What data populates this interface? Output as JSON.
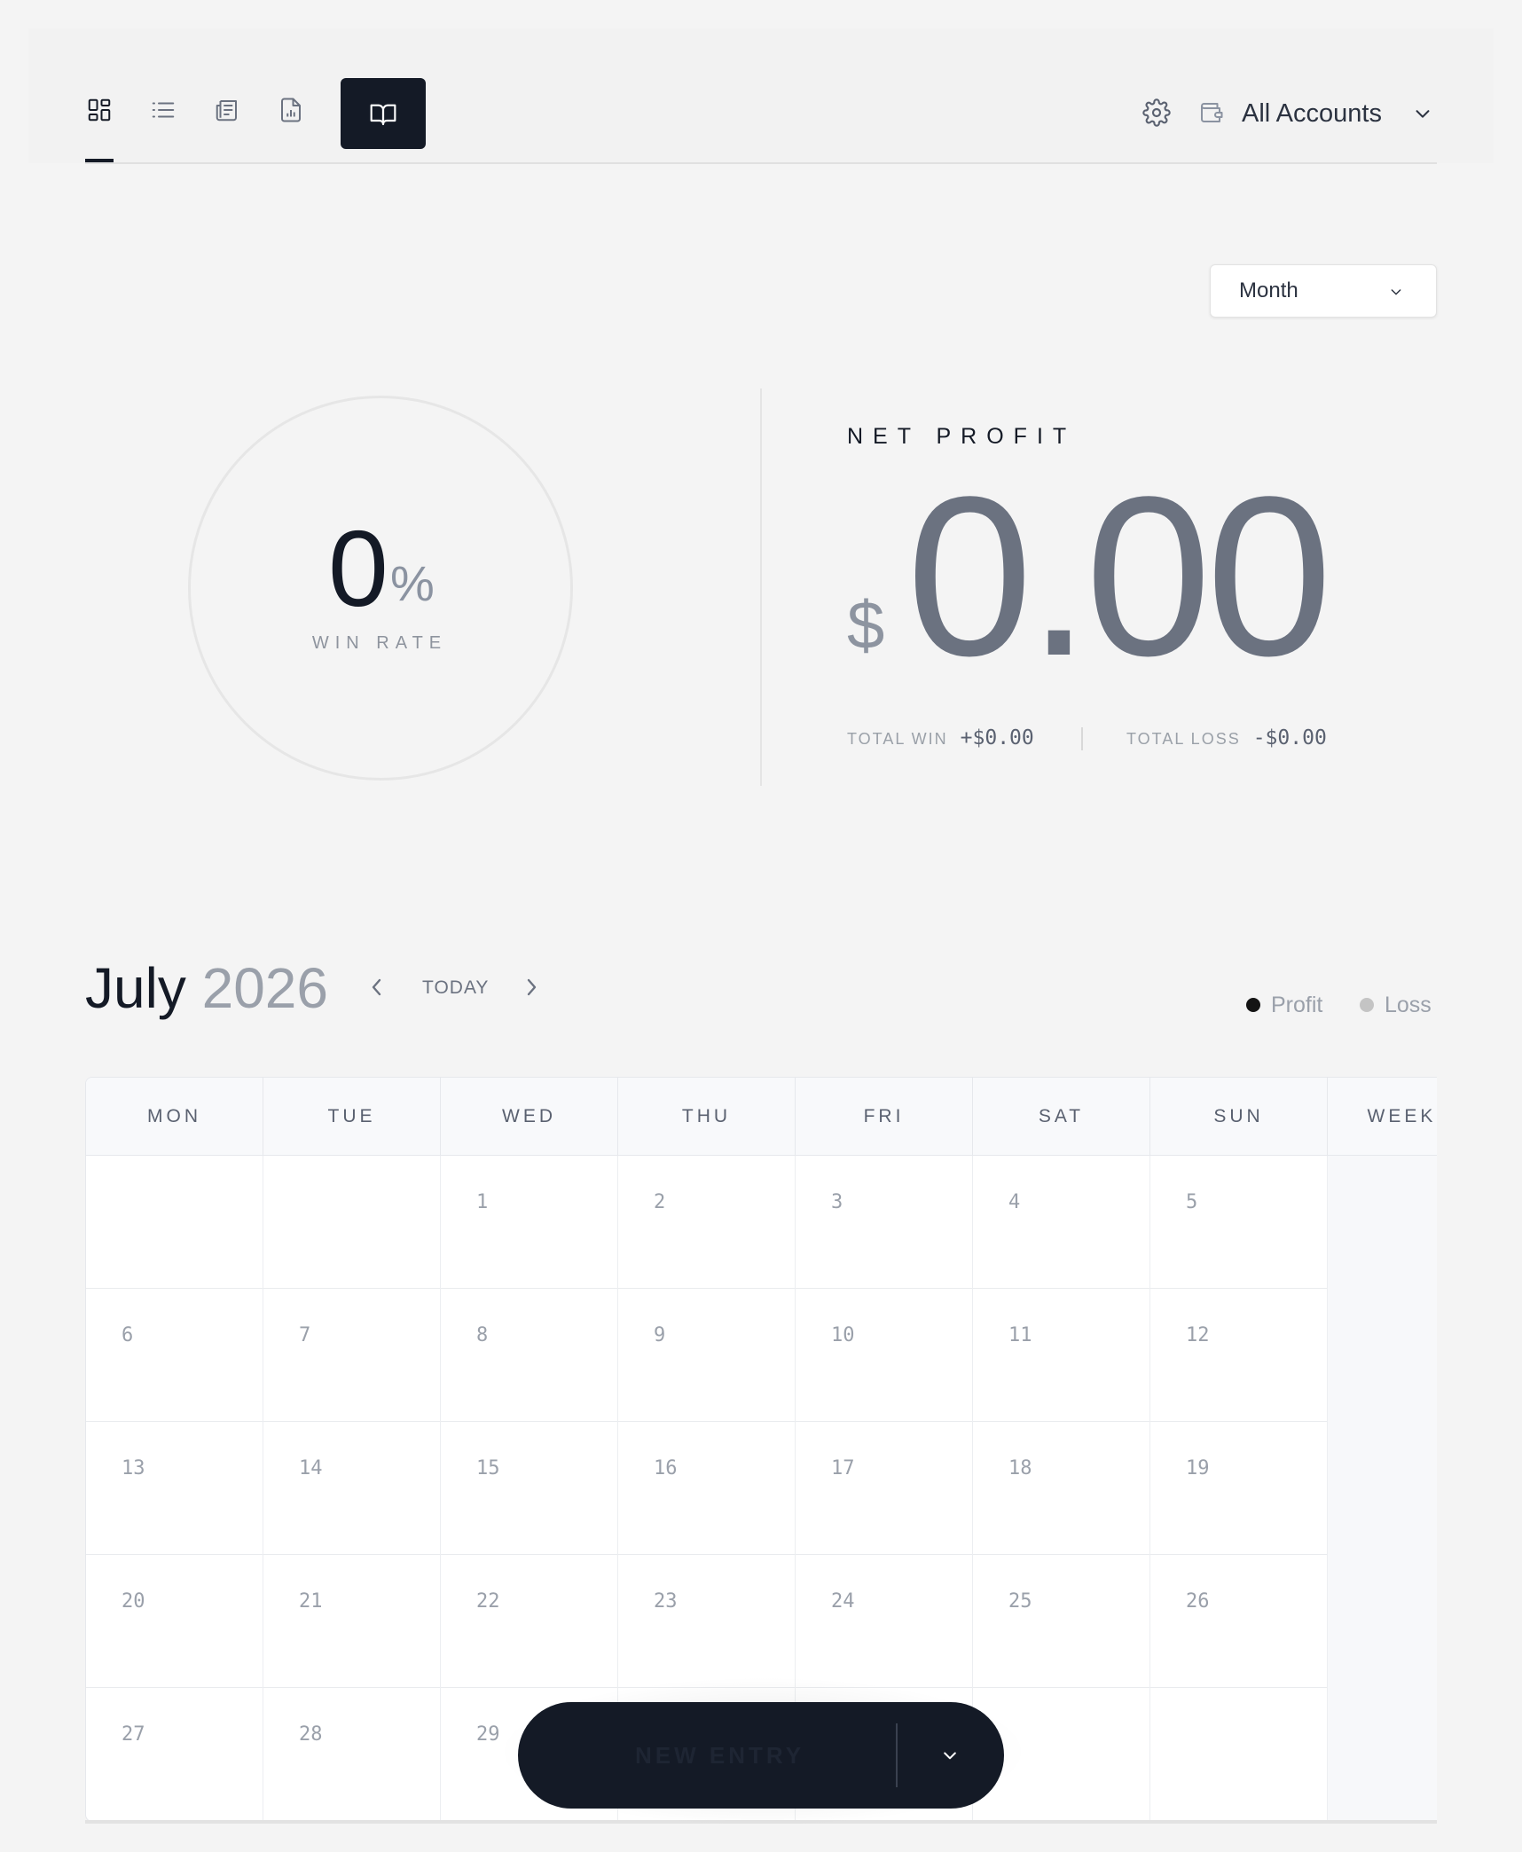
{
  "nav": {
    "views": [
      {
        "name": "dashboard",
        "icon": "dashboard-grid-icon"
      },
      {
        "name": "trades",
        "icon": "list-icon"
      },
      {
        "name": "news",
        "icon": "newspaper-icon"
      },
      {
        "name": "reports",
        "icon": "report-chart-icon"
      }
    ],
    "journal_icon": "open-book-icon",
    "settings_icon": "gear-icon",
    "account_icon": "wallet-icon",
    "account_label": "All Accounts"
  },
  "period": {
    "selected": "Month"
  },
  "win_rate": {
    "value": "0",
    "unit": "%",
    "label": "WIN RATE"
  },
  "net_profit": {
    "title": "NET PROFIT",
    "currency": "$",
    "value": "0.00",
    "total_win_label": "TOTAL WIN",
    "total_win": "+$0.00",
    "total_loss_label": "TOTAL LOSS",
    "total_loss": "-$0.00"
  },
  "calendar": {
    "month": "July",
    "year": "2026",
    "today_label": "TODAY",
    "legend": [
      {
        "label": "Profit",
        "color": "#141414"
      },
      {
        "label": "Loss",
        "color": "#c4c4c4"
      }
    ],
    "headers": [
      "MON",
      "TUE",
      "WED",
      "THU",
      "FRI",
      "SAT",
      "SUN",
      "WEEKLY"
    ],
    "weeks": [
      [
        "",
        "",
        "1",
        "2",
        "3",
        "4",
        "5"
      ],
      [
        "6",
        "7",
        "8",
        "9",
        "10",
        "11",
        "12"
      ],
      [
        "13",
        "14",
        "15",
        "16",
        "17",
        "18",
        "19"
      ],
      [
        "20",
        "21",
        "22",
        "23",
        "24",
        "25",
        "26"
      ],
      [
        "27",
        "28",
        "29",
        "",
        "",
        "",
        ""
      ]
    ]
  },
  "fab": {
    "label": "NEW ENTRY"
  },
  "colors": {
    "accent": "#141a26",
    "muted": "#9aa0aa"
  }
}
